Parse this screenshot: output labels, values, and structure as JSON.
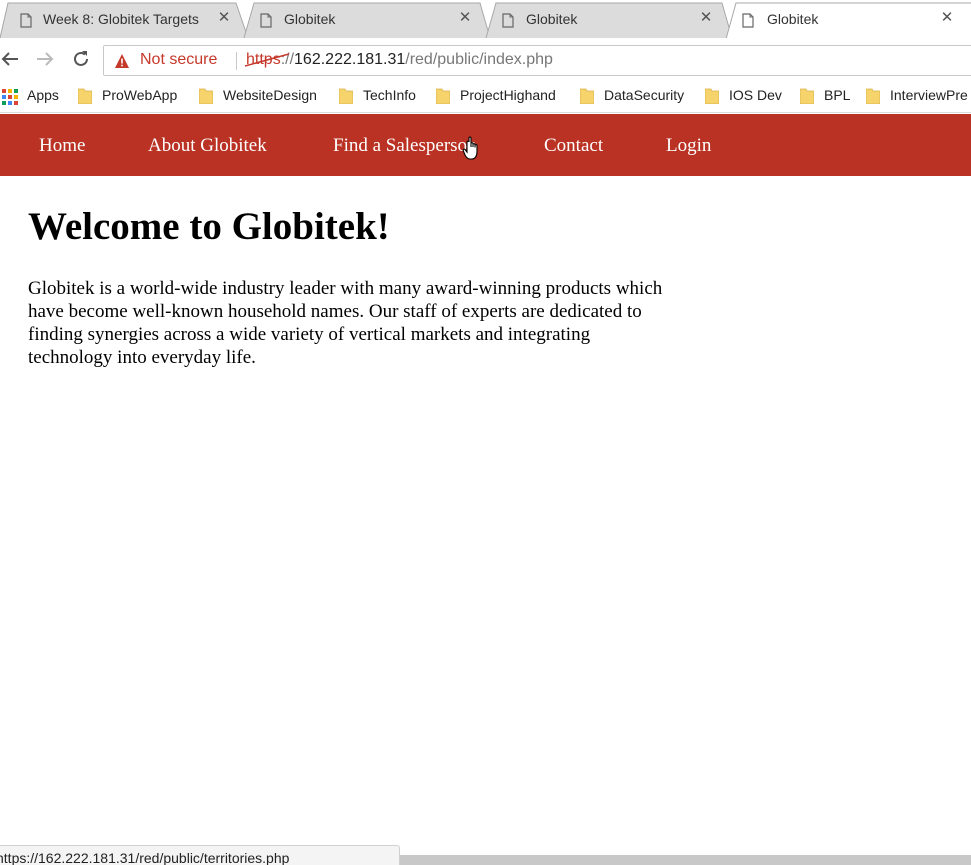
{
  "browser": {
    "tabs": [
      {
        "title": "Week 8: Globitek Targets",
        "active": false
      },
      {
        "title": "Globitek",
        "active": false
      },
      {
        "title": "Globitek",
        "active": false
      },
      {
        "title": "Globitek",
        "active": true
      }
    ],
    "close_glyph": "✕",
    "address": {
      "security_label": "Not secure",
      "scheme": "https",
      "scheme_sep": "://",
      "host": "162.222.181.31",
      "path": "/red/public/index.php"
    },
    "bookmarks": [
      {
        "label": "Apps",
        "icon": "apps-grid-icon"
      },
      {
        "label": "ProWebApp",
        "icon": "folder-icon"
      },
      {
        "label": "WebsiteDesign",
        "icon": "folder-icon"
      },
      {
        "label": "TechInfo",
        "icon": "folder-icon"
      },
      {
        "label": "ProjectHighand",
        "icon": "folder-icon"
      },
      {
        "label": "DataSecurity",
        "icon": "folder-icon"
      },
      {
        "label": "IOS Dev",
        "icon": "folder-icon"
      },
      {
        "label": "BPL",
        "icon": "folder-icon"
      },
      {
        "label": "InterviewPre",
        "icon": "folder-icon"
      }
    ],
    "status_url": "https://162.222.181.31/red/public/territories.php"
  },
  "site": {
    "nav": [
      {
        "label": "Home"
      },
      {
        "label": "About Globitek"
      },
      {
        "label": "Find a Salesperson"
      },
      {
        "label": "Contact"
      },
      {
        "label": "Login"
      }
    ],
    "heading": "Welcome to Globitek!",
    "intro": "Globitek is a world-wide industry leader with many award-winning products which have become well-known household names. Our staff of experts are dedicated to finding synergies across a wide variety of vertical markets and integrating technology into everyday life."
  },
  "colors": {
    "nav_background": "#b93224",
    "not_secure": "#c5392a",
    "folder": "#f6d36b"
  }
}
